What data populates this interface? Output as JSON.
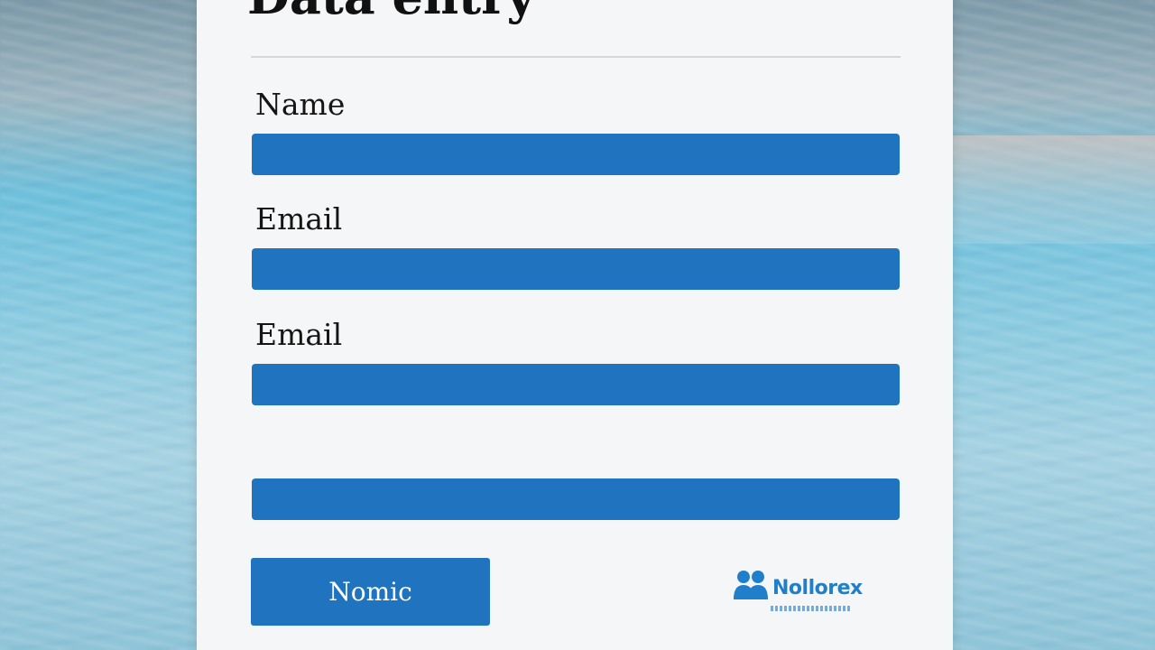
{
  "form": {
    "title": "Data entry",
    "fields": [
      {
        "label": "Name",
        "value": ""
      },
      {
        "label": "Email",
        "value": ""
      },
      {
        "label": "Email",
        "value": ""
      },
      {
        "label": "",
        "value": ""
      }
    ],
    "submit_label": "Nomic"
  },
  "logo": {
    "icon": "people-icon",
    "text": "Nollorex"
  },
  "colors": {
    "accent": "#1f73bf",
    "card": "#f5f6f8",
    "logo_text": "#1f7fca"
  }
}
